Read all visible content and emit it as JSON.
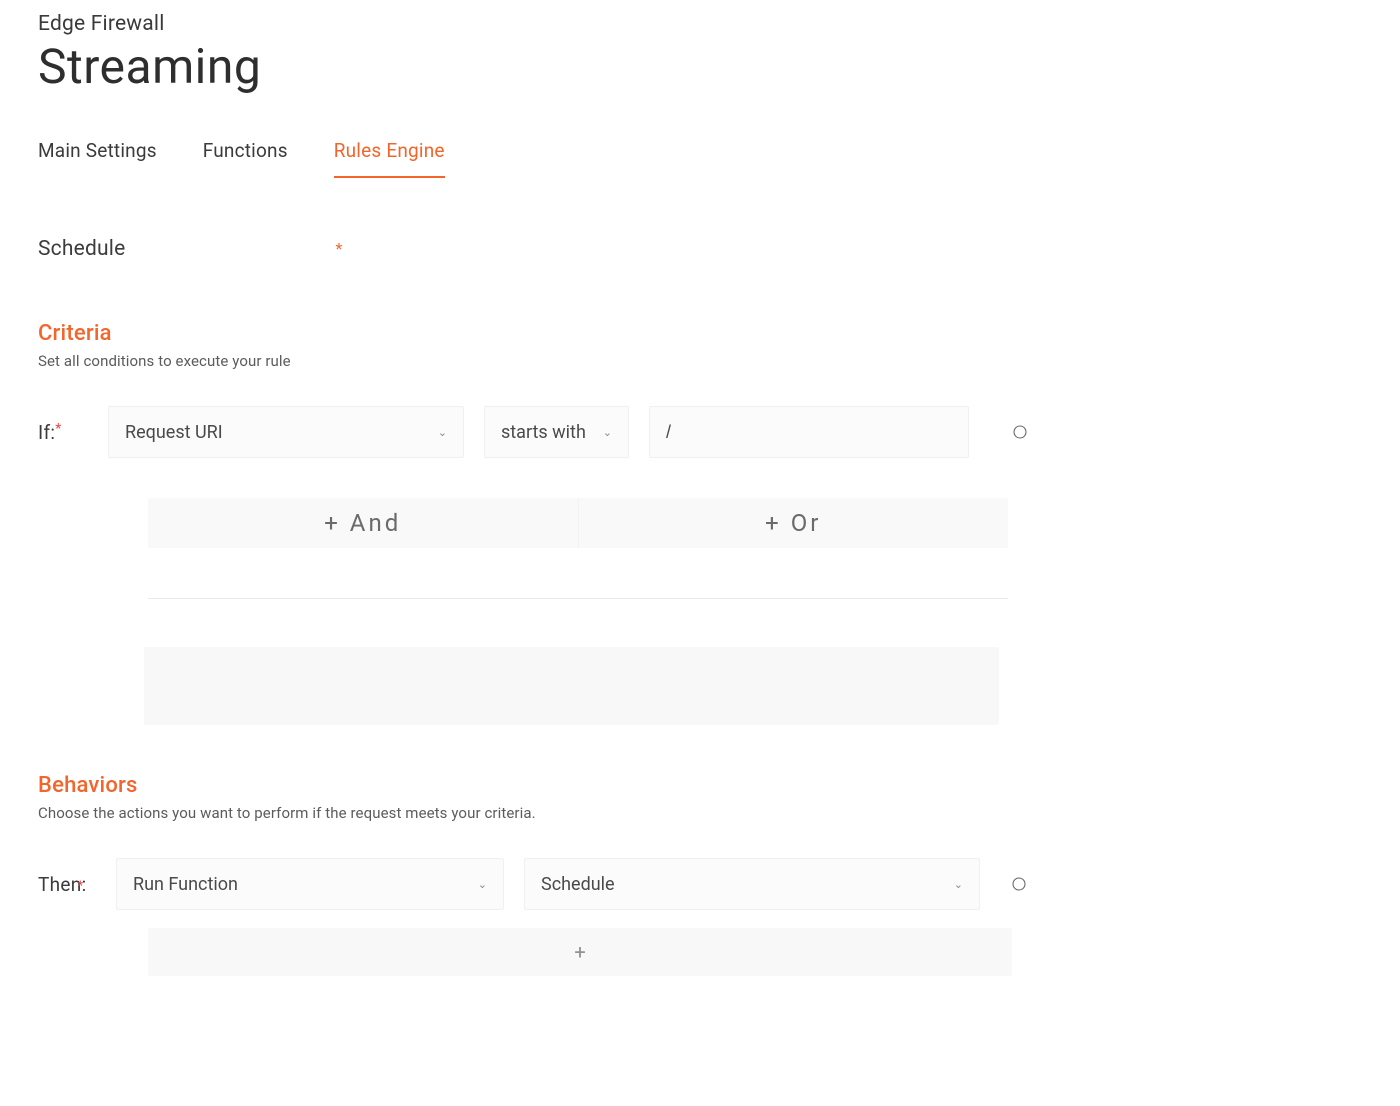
{
  "breadcrumb": "Edge Firewall",
  "title": "Streaming",
  "tabs": {
    "main": "Main Settings",
    "functions": "Functions",
    "rules": "Rules Engine"
  },
  "rule": {
    "name": "Schedule",
    "bullet": "*"
  },
  "criteria": {
    "heading": "Criteria",
    "sub": "Set all conditions to execute your rule",
    "if_label": "If:",
    "if_required": "*",
    "variable": "Request URI",
    "operator": "starts with",
    "value": "/",
    "and_label": "+ And",
    "or_label": "+ Or"
  },
  "behaviors": {
    "heading": "Behaviors",
    "sub": "Choose the actions you want to perform if the request meets your criteria.",
    "then_label": "Then:",
    "then_required": "*",
    "behavior": "Run Function",
    "function": "Schedule",
    "add_label": "+"
  }
}
